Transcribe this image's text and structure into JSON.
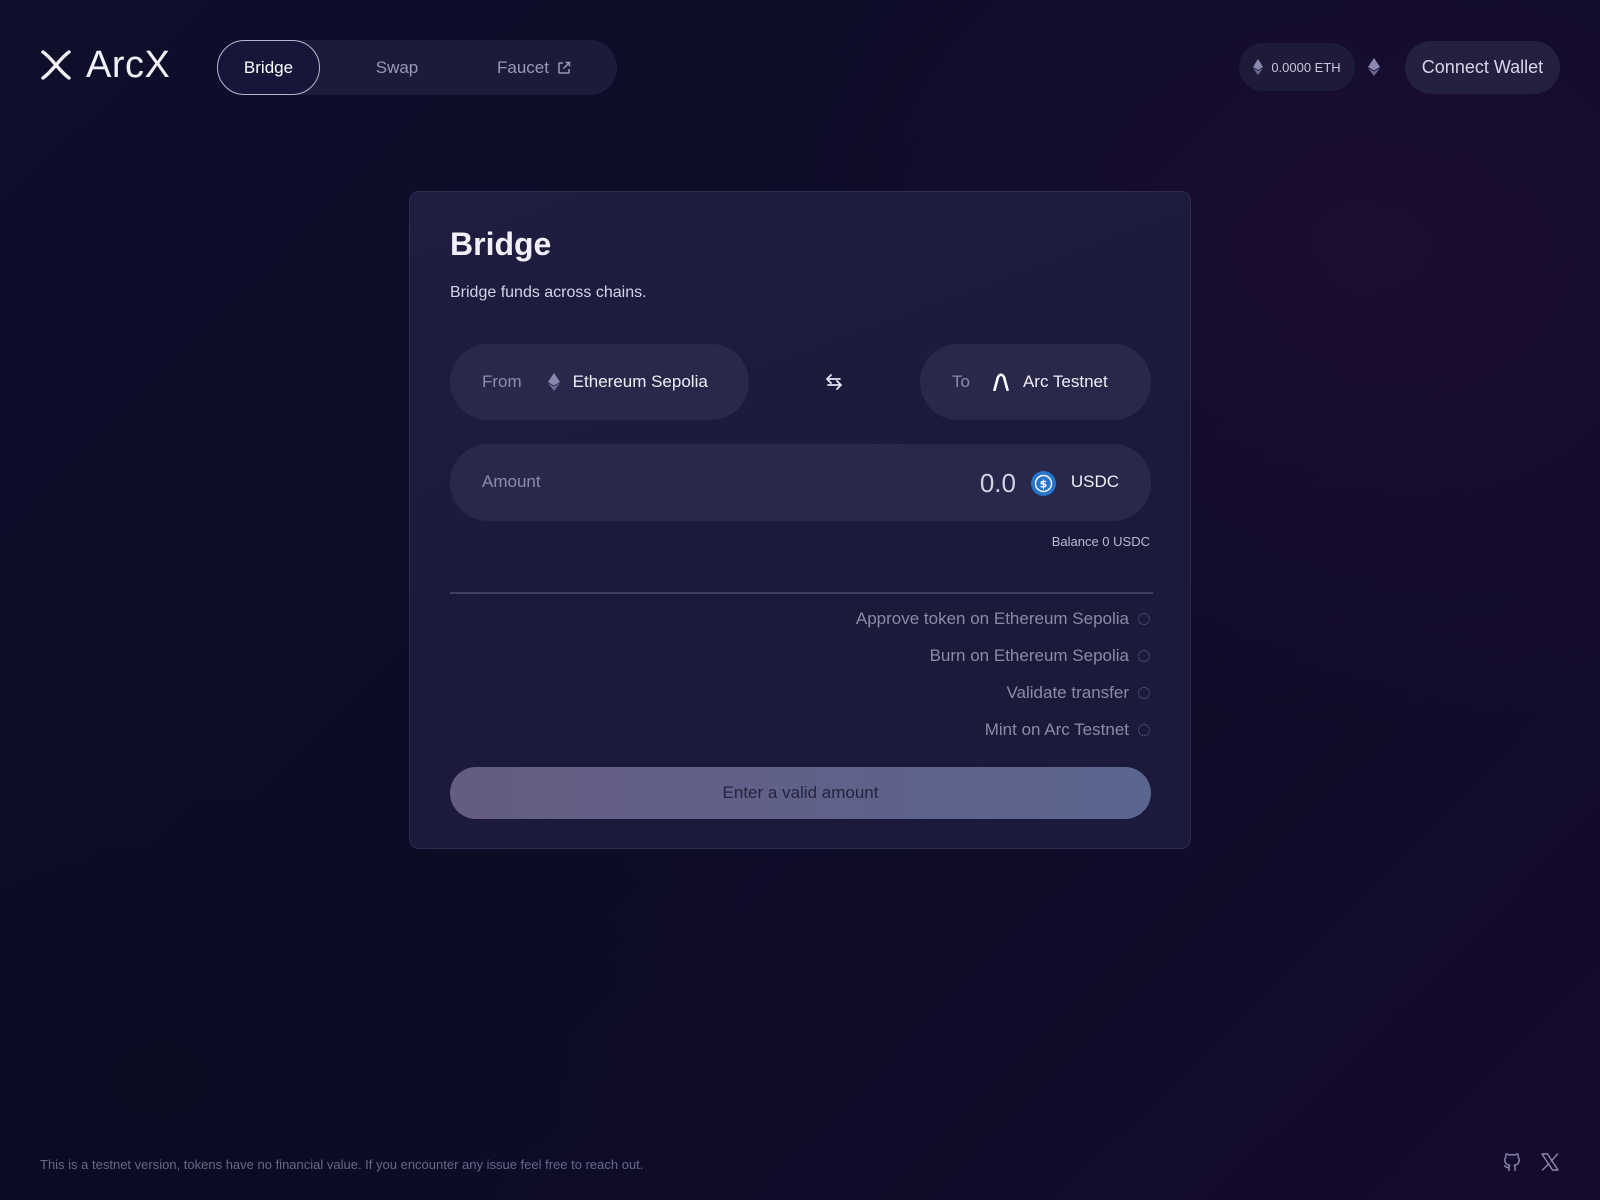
{
  "header": {
    "brand": "ArcX",
    "nav": [
      {
        "label": "Bridge",
        "active": true
      },
      {
        "label": "Swap",
        "active": false
      },
      {
        "label": "Faucet",
        "active": false,
        "external": true
      }
    ],
    "eth_balance": "0.0000 ETH",
    "connect_label": "Connect Wallet"
  },
  "bridge": {
    "title": "Bridge",
    "subtitle": "Bridge funds across chains.",
    "from": {
      "label": "From",
      "chain": "Ethereum Sepolia",
      "icon": "ethereum-icon"
    },
    "to": {
      "label": "To",
      "chain": "Arc Testnet",
      "icon": "arc-icon"
    },
    "amount": {
      "label": "Amount",
      "placeholder": "0.0",
      "value": "",
      "token": "USDC",
      "token_icon": "usdc-icon"
    },
    "balance": "Balance 0 USDC",
    "steps": [
      "Approve token on Ethereum Sepolia",
      "Burn on Ethereum Sepolia",
      "Validate transfer",
      "Mint on Arc Testnet"
    ],
    "submit_label": "Enter a valid amount"
  },
  "footer": {
    "note": "This is a testnet version, tokens have no financial value. If you encounter any issue feel free to reach out.",
    "icons": [
      "github-icon",
      "x-icon"
    ]
  },
  "colors": {
    "background": "#0e0e2a",
    "card": "#1e1c3f",
    "pill": "#2c2a4e",
    "button_start": "#655c82",
    "button_end": "#5a6690",
    "usdc": "#2775ca"
  }
}
